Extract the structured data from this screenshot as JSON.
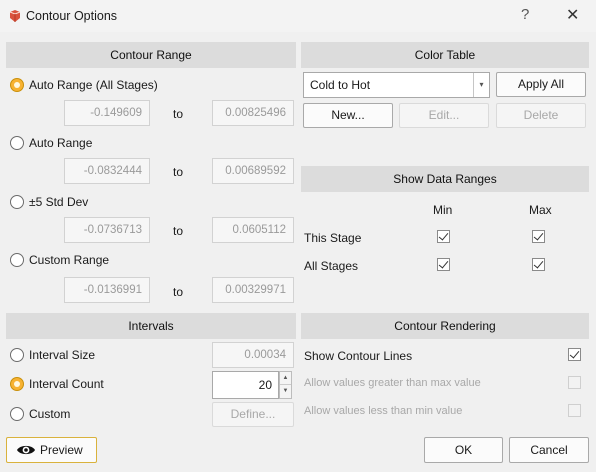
{
  "window": {
    "title": "Contour Options",
    "help_label": "?",
    "close_label": "✕"
  },
  "contour_range": {
    "header": "Contour Range",
    "options": [
      {
        "label": "Auto Range (All Stages)",
        "checked": true,
        "from": "-0.149609",
        "to": "0.00825496"
      },
      {
        "label": "Auto Range",
        "checked": false,
        "from": "-0.0832444",
        "to": "0.00689592"
      },
      {
        "label": "±5 Std Dev",
        "checked": false,
        "from": "-0.0736713",
        "to": "0.0605112"
      },
      {
        "label": "Custom Range",
        "checked": false,
        "from": "-0.0136991",
        "to": "0.00329971"
      }
    ],
    "to_label": "to"
  },
  "color_table": {
    "header": "Color Table",
    "selected": "Cold to Hot",
    "apply_all_label": "Apply All",
    "new_label": "New...",
    "edit_label": "Edit...",
    "delete_label": "Delete"
  },
  "show_data_ranges": {
    "header": "Show Data Ranges",
    "col_min": "Min",
    "col_max": "Max",
    "rows": [
      {
        "label": "This Stage",
        "min": true,
        "max": true
      },
      {
        "label": "All Stages",
        "min": true,
        "max": true
      }
    ]
  },
  "intervals": {
    "header": "Intervals",
    "interval_size_label": "Interval Size",
    "interval_size_value": "0.00034",
    "interval_count_label": "Interval Count",
    "interval_count_value": "20",
    "custom_label": "Custom",
    "define_label": "Define..."
  },
  "contour_rendering": {
    "header": "Contour Rendering",
    "show_lines_label": "Show Contour Lines",
    "show_lines_checked": true,
    "allow_greater_label": "Allow values greater than max value",
    "allow_less_label": "Allow values less than min value"
  },
  "footer": {
    "preview_label": "Preview",
    "ok_label": "OK",
    "cancel_label": "Cancel"
  },
  "colors": {
    "accent": "#f7b232",
    "header_bg": "#dcdcdc",
    "dialog_bg": "#f0f0f0",
    "app_icon": "#d9533c"
  }
}
